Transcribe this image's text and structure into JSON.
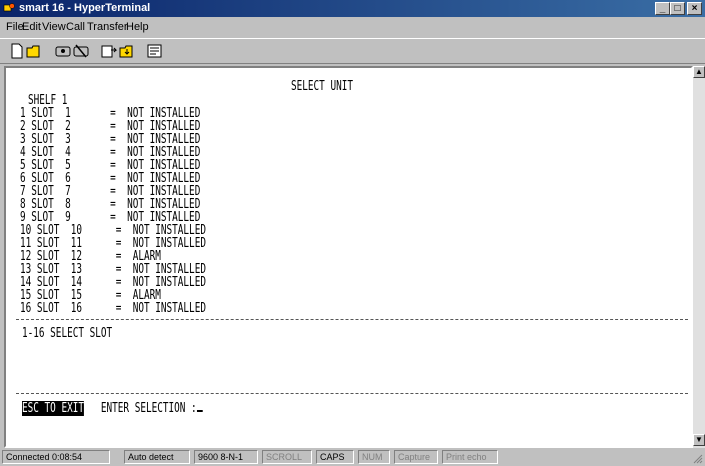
{
  "window": {
    "title": "smart 16 - HyperTerminal"
  },
  "menu": {
    "items": [
      "File",
      "Edit",
      "View",
      "Call",
      "Transfer",
      "Help"
    ]
  },
  "toolbar": {
    "buttons": [
      "new-icon",
      "open-icon",
      "connect-icon",
      "disconnect-icon",
      "send-icon",
      "receive-icon",
      "properties-icon"
    ]
  },
  "terminal": {
    "header": "SELECT UNIT",
    "shelf": "SHELF 1",
    "rows": [
      "1 SLOT  1       =  NOT INSTALLED",
      "2 SLOT  2       =  NOT INSTALLED",
      "3 SLOT  3       =  NOT INSTALLED",
      "4 SLOT  4       =  NOT INSTALLED",
      "5 SLOT  5       =  NOT INSTALLED",
      "6 SLOT  6       =  NOT INSTALLED",
      "7 SLOT  7       =  NOT INSTALLED",
      "8 SLOT  8       =  NOT INSTALLED",
      "9 SLOT  9       =  NOT INSTALLED",
      "10 SLOT  10      =  NOT INSTALLED",
      "11 SLOT  11      =  NOT INSTALLED",
      "12 SLOT  12      =  ALARM",
      "13 SLOT  13      =  NOT INSTALLED",
      "14 SLOT  14      =  NOT INSTALLED",
      "15 SLOT  15      =  ALARM",
      "16 SLOT  16      =  NOT INSTALLED"
    ],
    "hint": "1-16 SELECT SLOT",
    "esc": "ESC TO EXIT",
    "prompt": "ENTER SELECTION :"
  },
  "status": {
    "connected": "Connected 0:08:54",
    "detect": "Auto detect",
    "settings": "9600 8-N-1",
    "scroll": "SCROLL",
    "caps": "CAPS",
    "num": "NUM",
    "capture": "Capture",
    "echo": "Print echo"
  }
}
